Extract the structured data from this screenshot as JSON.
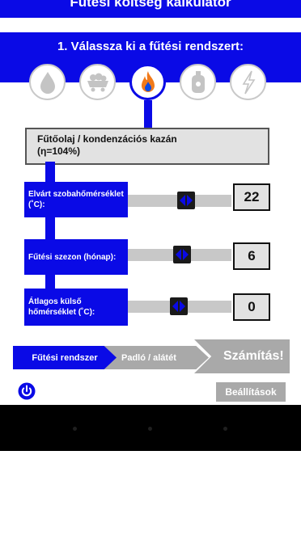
{
  "header": {
    "title": "Fűtési költség kalkulátor"
  },
  "step": {
    "title": "1. Válassza ki a fűtési rendszert:"
  },
  "fuels": [
    {
      "icon": "oil-drop-icon",
      "selected": false
    },
    {
      "icon": "coal-cart-icon",
      "selected": false
    },
    {
      "icon": "gas-flame-icon",
      "selected": true
    },
    {
      "icon": "gas-bottle-icon",
      "selected": false
    },
    {
      "icon": "electricity-bolt-icon",
      "selected": false
    }
  ],
  "selected_system": {
    "line1": "Fűtőolaj / kondenzációs kazán",
    "line2": "(η=104%)"
  },
  "sliders": [
    {
      "label": "Elvárt szobahőmérséklet (˚C):",
      "value": "22",
      "level": 0.6
    },
    {
      "label": "Fűtési szezon (hónap):",
      "value": "6",
      "level": 0.54
    },
    {
      "label": "Átlagos külső hőmérséklet (˚C):",
      "value": "0",
      "level": 0.42
    }
  ],
  "breadcrumb": {
    "step1": "Fűtési rendszer",
    "step2": "Padló / alátét",
    "step3": "Számítás!"
  },
  "footer": {
    "settings": "Beállítások"
  },
  "colors": {
    "primary": "#0a0ae6",
    "inactive": "#a9a9a9",
    "panel": "#e2e2e2"
  }
}
